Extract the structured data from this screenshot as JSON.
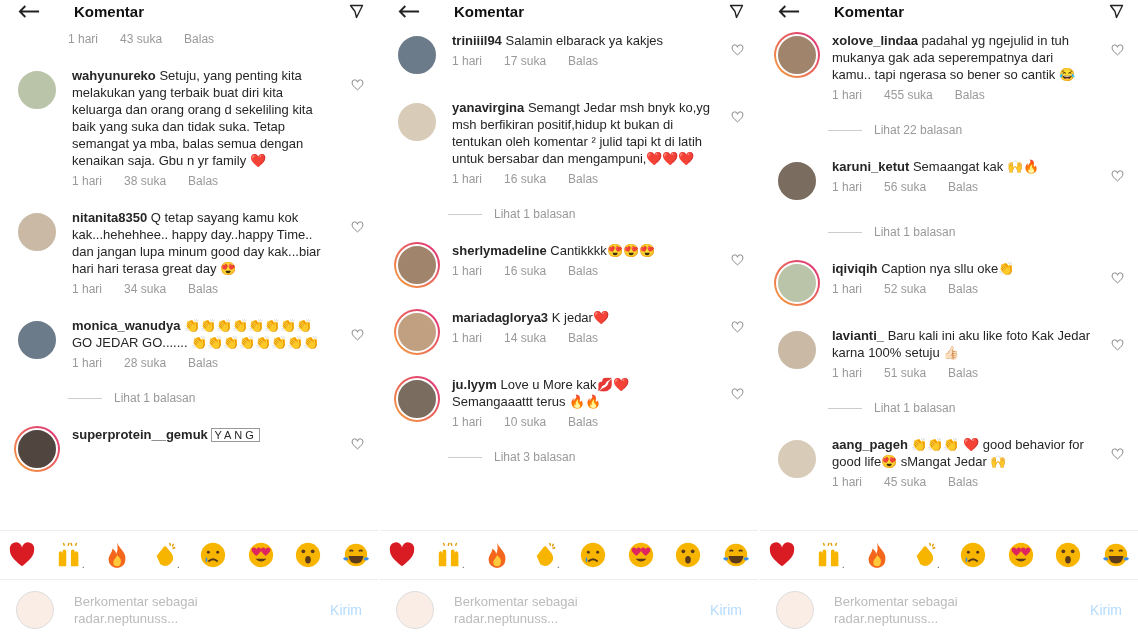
{
  "panels": [
    {
      "title": "Komentar",
      "comments": [
        {
          "kind": "meta",
          "time": "1 hari",
          "likes": "43 suka",
          "reply": "Balas"
        },
        {
          "kind": "comment",
          "username": "wahyunureko",
          "text": "Setuju, yang penting kita melakukan yang terbaik buat diri kita keluarga dan orang orang d sekeliling kita baik yang suka dan tidak suka. Tetap semangat ya mba, balas semua dengan kenaikan saja. Gbu n yr family ❤️",
          "time": "1 hari",
          "likes": "38 suka",
          "reply": "Balas",
          "story_ring": false
        },
        {
          "kind": "comment",
          "username": "nitanita8350",
          "text": "Q tetap sayang kamu kok kak...hehehhee.. happy day..happy Time.. dan jangan lupa minum good day kak...biar hari hari terasa great day 😍",
          "time": "1 hari",
          "likes": "34 suka",
          "reply": "Balas",
          "story_ring": false
        },
        {
          "kind": "comment",
          "username": "monica_wanudya",
          "text": "👏👏👏👏👏👏👏👏 GO JEDAR GO....... 👏👏👏👏👏👏👏👏",
          "time": "1 hari",
          "likes": "28 suka",
          "reply": "Balas",
          "story_ring": false
        },
        {
          "kind": "replies",
          "label": "Lihat 1 balasan"
        },
        {
          "kind": "comment",
          "username": "superprotein__gemuk",
          "text": "YANG",
          "boxed": true,
          "story_ring": true
        }
      ],
      "composer": {
        "placeholder": "Berkomentar sebagai radar.neptunuss...",
        "send": "Kirim"
      }
    },
    {
      "title": "Komentar",
      "comments": [
        {
          "kind": "comment",
          "username": "triniiil94",
          "text": "Salamin elbarack ya kakjes",
          "time": "1 hari",
          "likes": "17 suka",
          "reply": "Balas",
          "story_ring": false
        },
        {
          "kind": "comment",
          "username": "yanavirgina",
          "text": "Semangt Jedar msh bnyk ko,yg msh berfikiran positif,hidup kt bukan di tentukan oleh komentar ² julid tapi kt di latih untuk bersabar dan mengampuni,❤️❤️❤️",
          "time": "1 hari",
          "likes": "16 suka",
          "reply": "Balas",
          "story_ring": false
        },
        {
          "kind": "replies",
          "label": "Lihat 1 balasan"
        },
        {
          "kind": "comment",
          "username": "sherlymadeline",
          "text": "Cantikkkk😍😍😍",
          "time": "1 hari",
          "likes": "16 suka",
          "reply": "Balas",
          "story_ring": true
        },
        {
          "kind": "comment",
          "username": "mariadaglorya3",
          "text": "K jedar❤️",
          "time": "1 hari",
          "likes": "14 suka",
          "reply": "Balas",
          "story_ring": true
        },
        {
          "kind": "comment",
          "username": "ju.lyym",
          "text": "Love u More kak💋❤️ Semangaaattt terus 🔥🔥",
          "time": "1 hari",
          "likes": "10 suka",
          "reply": "Balas",
          "story_ring": true
        },
        {
          "kind": "replies",
          "label": "Lihat 3 balasan"
        }
      ],
      "composer": {
        "placeholder": "Berkomentar sebagai radar.neptunuss...",
        "send": "Kirim"
      }
    },
    {
      "title": "Komentar",
      "comments": [
        {
          "kind": "comment",
          "username": "xolove_lindaa",
          "text": "padahal yg ngejulid in tuh mukanya gak ada seperempatnya dari kamu.. tapi ngerasa so bener so cantik 😂",
          "time": "1 hari",
          "likes": "455 suka",
          "reply": "Balas",
          "story_ring": true
        },
        {
          "kind": "replies",
          "label": "Lihat 22 balasan"
        },
        {
          "kind": "comment",
          "username": "karuni_ketut",
          "text": "Semaangat kak 🙌🔥",
          "time": "1 hari",
          "likes": "56 suka",
          "reply": "Balas",
          "story_ring": false
        },
        {
          "kind": "replies",
          "label": "Lihat 1 balasan"
        },
        {
          "kind": "comment",
          "username": "iqiviqih",
          "text": "Caption nya sllu oke👏",
          "time": "1 hari",
          "likes": "52 suka",
          "reply": "Balas",
          "story_ring": true
        },
        {
          "kind": "comment",
          "username": "lavianti_",
          "text": "Baru kali ini aku like foto Kak Jedar karna 100% setuju 👍🏻",
          "time": "1 hari",
          "likes": "51 suka",
          "reply": "Balas",
          "story_ring": false
        },
        {
          "kind": "replies",
          "label": "Lihat 1 balasan"
        },
        {
          "kind": "comment",
          "username": "aang_pageh",
          "text": "👏👏👏 ❤️ good behavior for good life😍 sMangat Jedar 🙌",
          "time": "1 hari",
          "likes": "45 suka",
          "reply": "Balas",
          "story_ring": false
        }
      ],
      "composer": {
        "placeholder": "Berkomentar sebagai radar.neptunuss...",
        "send": "Kirim"
      }
    }
  ]
}
